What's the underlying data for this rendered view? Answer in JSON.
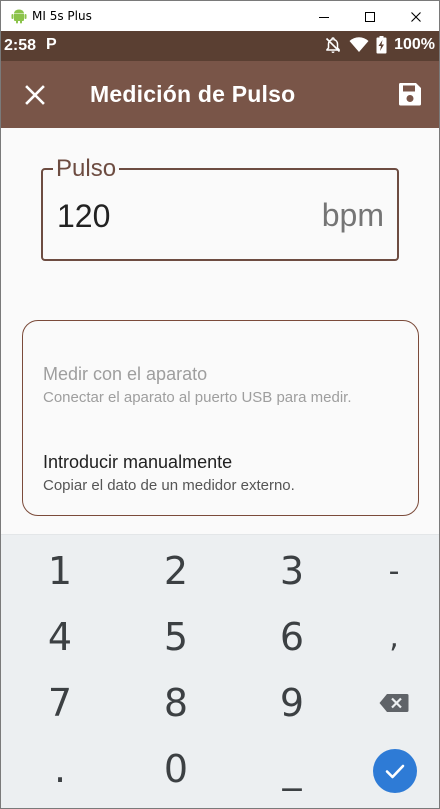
{
  "window": {
    "title": "MI 5s Plus",
    "minimize_glyph": "—",
    "maximize_glyph": "☐",
    "close_glyph": "✕"
  },
  "statusbar": {
    "time": "2:58",
    "notification_letter": "P",
    "battery_percent": "100%",
    "icons": [
      "mute-bell-icon",
      "wifi-icon",
      "battery-charging-icon"
    ]
  },
  "appbar": {
    "title": "Medición de Pulso",
    "close_icon": "close-icon",
    "save_icon": "save-icon",
    "color": "#795548"
  },
  "pulse_field": {
    "label": "Pulso",
    "value": "120",
    "unit": "bpm"
  },
  "options": [
    {
      "title": "Medir con el aparato",
      "subtitle": "Conectar el aparato al puerto USB para medir.",
      "enabled": false
    },
    {
      "title": "Introducir manualmente",
      "subtitle": "Copiar el dato de un medidor externo.",
      "enabled": true
    }
  ],
  "keyboard": {
    "rows": [
      [
        "1",
        "2",
        "3",
        "-"
      ],
      [
        "4",
        "5",
        "6",
        ","
      ],
      [
        "7",
        "8",
        "9",
        "backspace"
      ],
      [
        ".",
        "0",
        "_",
        "enter"
      ]
    ],
    "enter_color": "#2e7bd6"
  }
}
